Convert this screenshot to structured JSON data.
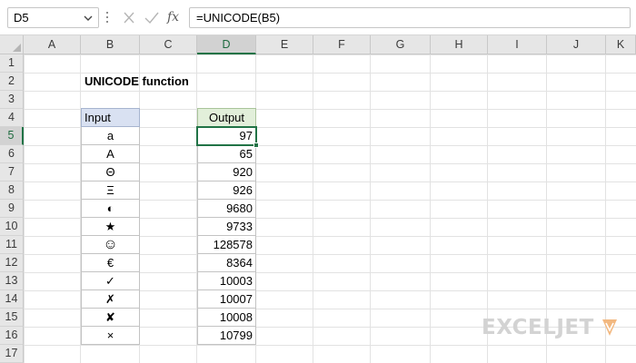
{
  "formula_bar": {
    "name_box": "D5",
    "formula": "=UNICODE(B5)",
    "fx_label": "fx",
    "icons": {
      "cancel": "x-icon",
      "enter": "check-icon",
      "insert_function": "fx-icon",
      "dropdown": "chevron-down-icon"
    }
  },
  "columns": [
    "A",
    "B",
    "C",
    "D",
    "E",
    "F",
    "G",
    "H",
    "I",
    "J",
    "K"
  ],
  "rows": [
    "1",
    "2",
    "3",
    "4",
    "5",
    "6",
    "7",
    "8",
    "9",
    "10",
    "11",
    "12",
    "13",
    "14",
    "15",
    "16",
    "17"
  ],
  "selected": {
    "column": "D",
    "row": "5"
  },
  "sheet": {
    "title": "UNICODE function",
    "input_header": "Input",
    "output_header": "Output",
    "inputs": [
      "a",
      "A",
      "Θ",
      "Ξ",
      "◐",
      "★",
      "☺",
      "€",
      "✓",
      "✗",
      "✘",
      "×"
    ],
    "outputs": [
      "97",
      "65",
      "920",
      "926",
      "9680",
      "9733",
      "128578",
      "8364",
      "10003",
      "10007",
      "10008",
      "10799"
    ]
  },
  "colors": {
    "accent": "#217346",
    "input_header_bg": "#d9e1f2",
    "output_header_bg": "#e2efda",
    "logo": "#d3d3d3",
    "logo_mark": "#f2b880"
  },
  "branding": {
    "logo_text": "EXCELJET"
  }
}
